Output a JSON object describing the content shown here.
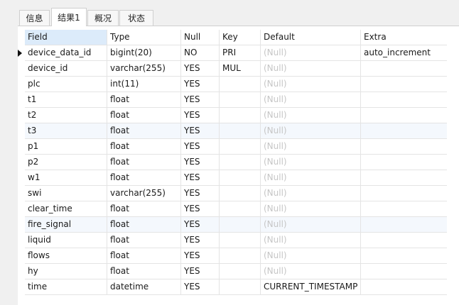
{
  "tabs": [
    {
      "label": "信息",
      "active": false
    },
    {
      "label": "结果1",
      "active": true
    },
    {
      "label": "概况",
      "active": false
    },
    {
      "label": "状态",
      "active": false
    }
  ],
  "table": {
    "columns": [
      "Field",
      "Type",
      "Null",
      "Key",
      "Default",
      "Extra"
    ],
    "rows": [
      {
        "field": "device_data_id",
        "type": "bigint(20)",
        "null": "NO",
        "key": "PRI",
        "default": "(Null)",
        "extra": "auto_increment"
      },
      {
        "field": "device_id",
        "type": "varchar(255)",
        "null": "YES",
        "key": "MUL",
        "default": "(Null)",
        "extra": ""
      },
      {
        "field": "plc",
        "type": "int(11)",
        "null": "YES",
        "key": "",
        "default": "(Null)",
        "extra": ""
      },
      {
        "field": "t1",
        "type": "float",
        "null": "YES",
        "key": "",
        "default": "(Null)",
        "extra": ""
      },
      {
        "field": "t2",
        "type": "float",
        "null": "YES",
        "key": "",
        "default": "(Null)",
        "extra": ""
      },
      {
        "field": "t3",
        "type": "float",
        "null": "YES",
        "key": "",
        "default": "(Null)",
        "extra": ""
      },
      {
        "field": "p1",
        "type": "float",
        "null": "YES",
        "key": "",
        "default": "(Null)",
        "extra": ""
      },
      {
        "field": "p2",
        "type": "float",
        "null": "YES",
        "key": "",
        "default": "(Null)",
        "extra": ""
      },
      {
        "field": "w1",
        "type": "float",
        "null": "YES",
        "key": "",
        "default": "(Null)",
        "extra": ""
      },
      {
        "field": "swi",
        "type": "varchar(255)",
        "null": "YES",
        "key": "",
        "default": "(Null)",
        "extra": ""
      },
      {
        "field": "clear_time",
        "type": "float",
        "null": "YES",
        "key": "",
        "default": "(Null)",
        "extra": ""
      },
      {
        "field": "fire_signal",
        "type": "float",
        "null": "YES",
        "key": "",
        "default": "(Null)",
        "extra": ""
      },
      {
        "field": "liquid",
        "type": "float",
        "null": "YES",
        "key": "",
        "default": "(Null)",
        "extra": ""
      },
      {
        "field": "flows",
        "type": "float",
        "null": "YES",
        "key": "",
        "default": "(Null)",
        "extra": ""
      },
      {
        "field": "hy",
        "type": "float",
        "null": "YES",
        "key": "",
        "default": "(Null)",
        "extra": ""
      },
      {
        "field": "time",
        "type": "datetime",
        "null": "YES",
        "key": "",
        "default": "CURRENT_TIMESTAMP",
        "extra": ""
      }
    ]
  }
}
